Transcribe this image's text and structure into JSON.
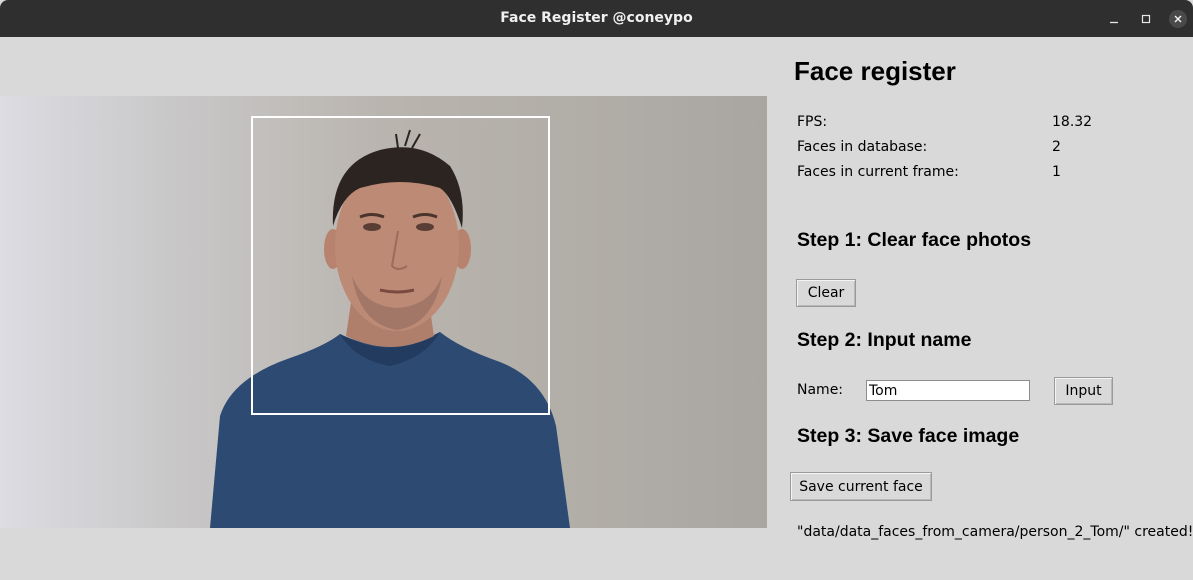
{
  "window": {
    "title": "Face Register @coneypo",
    "controls": [
      "minimize-icon",
      "maximize-icon",
      "close-icon"
    ]
  },
  "camera": {
    "faces_detected": 1,
    "face_box_color": "#ffffff"
  },
  "panel": {
    "title": "Face register",
    "info": {
      "fps_label": "FPS:",
      "fps_value": "18.32",
      "db_label": "Faces in database:",
      "db_value": "2",
      "frame_label": "Faces in current frame:",
      "frame_value": "1"
    },
    "step1": {
      "heading": "Step 1: Clear face photos",
      "clear_label": "Clear"
    },
    "step2": {
      "heading": "Step 2: Input name",
      "name_label": "Name:",
      "name_value": "Tom",
      "input_label": "Input"
    },
    "step3": {
      "heading": "Step 3: Save face image",
      "save_label": "Save current face"
    },
    "status": "\"data/data_faces_from_camera/person_2_Tom/\" created!"
  },
  "colors": {
    "titlebar": "#2f2f2f",
    "background": "#d9d9d9",
    "shirt": "#2c4a72"
  }
}
